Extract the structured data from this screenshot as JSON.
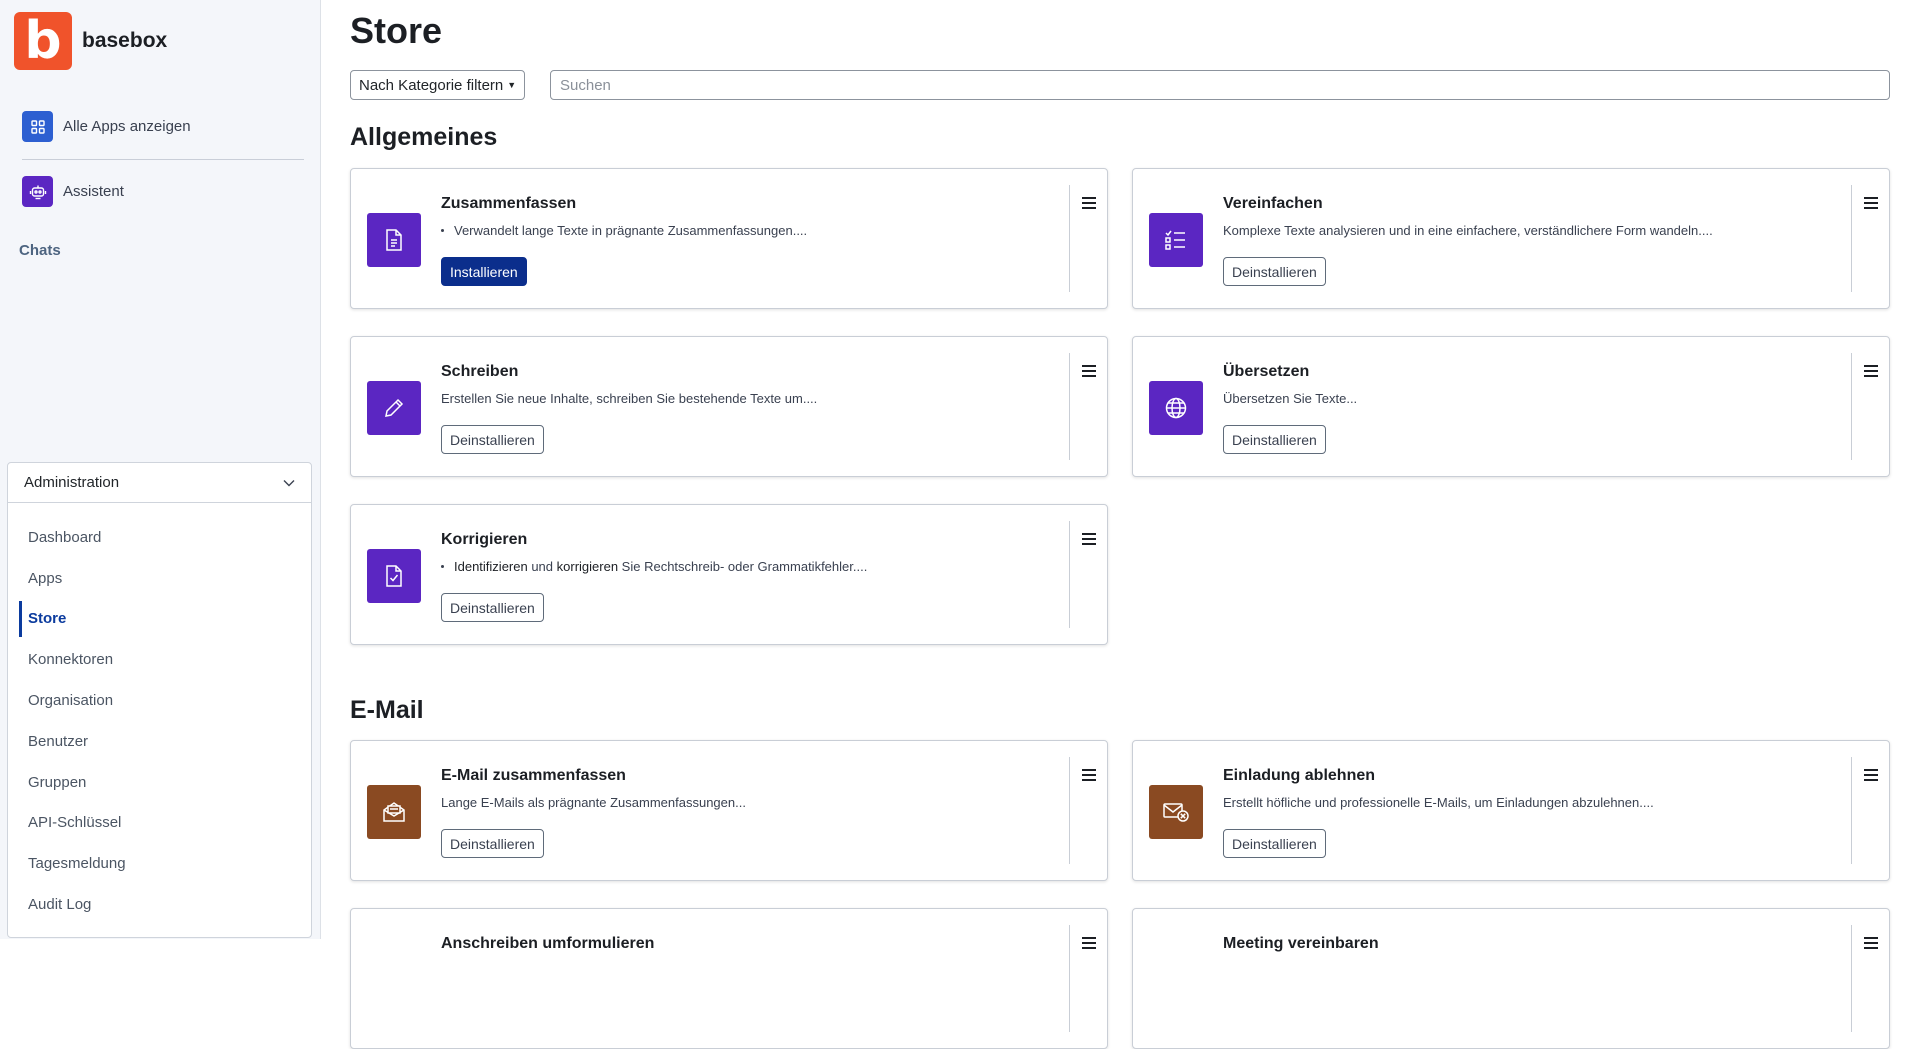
{
  "app": {
    "name": "basebox",
    "logo_letter": "b",
    "brand_color": "#f0532b"
  },
  "sidebar": {
    "all_apps_label": "Alle Apps anzeigen",
    "assistant_label": "Assistent",
    "chats_label": "Chats",
    "admin": {
      "label": "Administration",
      "items": [
        {
          "label": "Dashboard"
        },
        {
          "label": "Apps"
        },
        {
          "label": "Store"
        },
        {
          "label": "Konnektoren"
        },
        {
          "label": "Organisation"
        },
        {
          "label": "Benutzer"
        },
        {
          "label": "Gruppen"
        },
        {
          "label": "API-Schlüssel"
        },
        {
          "label": "Tagesmeldung"
        },
        {
          "label": "Audit Log"
        }
      ],
      "active_item": "Store"
    }
  },
  "main": {
    "title": "Store",
    "filter_label": "Nach Kategorie filtern",
    "search_placeholder": "Suchen",
    "sections": [
      {
        "title": "Allgemeines",
        "cards": [
          {
            "title": "Zusammenfassen",
            "description": "Verwandelt lange Texte in prägnante Zusammenfassungen....",
            "button": "Installieren",
            "icon": "document-icon",
            "icon_color": "#5b26c2"
          },
          {
            "title": "Vereinfachen",
            "description": "Komplexe Texte analysieren und in eine einfachere, verständlichere Form wandeln....",
            "button": "Deinstallieren",
            "icon": "list-check-icon",
            "icon_color": "#5b26c2"
          },
          {
            "title": "Schreiben",
            "description": "Erstellen Sie neue Inhalte, schreiben Sie bestehende Texte um....",
            "button": "Deinstallieren",
            "icon": "pencil-icon",
            "icon_color": "#5b26c2"
          },
          {
            "title": "Übersetzen",
            "description": "Übersetzen Sie Texte...",
            "button": "Deinstallieren",
            "icon": "globe-icon",
            "icon_color": "#5b26c2"
          },
          {
            "title": "Korrigieren",
            "description_parts": [
              "Identifizieren",
              " und ",
              "korrigieren",
              " Sie Rechtschreib- oder Grammatikfehler...."
            ],
            "button": "Deinstallieren",
            "icon": "file-check-icon",
            "icon_color": "#5b26c2"
          }
        ]
      },
      {
        "title": "E-Mail",
        "cards": [
          {
            "title": "E-Mail zusammenfassen",
            "description": "Lange E-Mails als prägnante Zusammenfassungen...",
            "button": "Deinstallieren",
            "icon": "mail-open-icon",
            "icon_color": "#8a4a22"
          },
          {
            "title": "Einladung ablehnen",
            "description": "Erstellt höfliche und professionelle E-Mails, um Einladungen abzulehnen....",
            "button": "Deinstallieren",
            "icon": "mail-x-icon",
            "icon_color": "#8a4a22"
          },
          {
            "title": "Anschreiben umformulieren"
          },
          {
            "title": "Meeting vereinbaren"
          }
        ]
      }
    ]
  }
}
